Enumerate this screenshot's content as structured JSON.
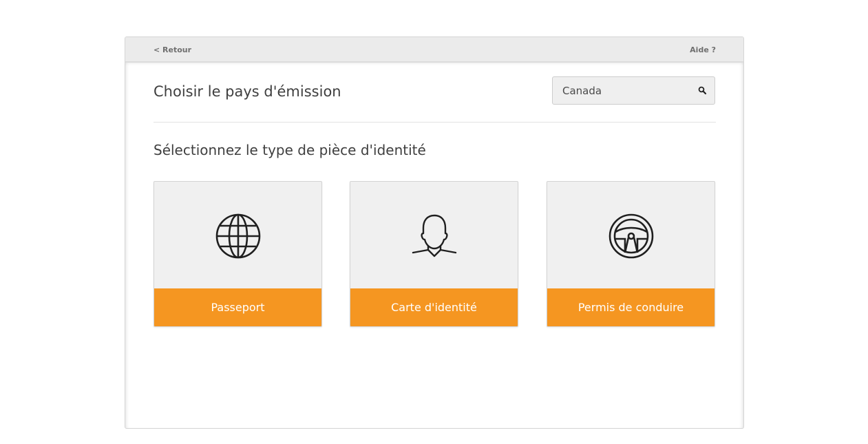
{
  "header": {
    "back_label": "< Retour",
    "help_label": "Aide ?"
  },
  "country": {
    "title": "Choisir le pays d'émission",
    "search_value": "Canada",
    "search_icon": "search-icon"
  },
  "document_type": {
    "title": "Sélectionnez le type de pièce d'identité",
    "options": [
      {
        "label": "Passeport",
        "icon": "globe-icon"
      },
      {
        "label": "Carte d'identité",
        "icon": "person-icon"
      },
      {
        "label": "Permis de conduire",
        "icon": "steering-wheel-icon"
      }
    ]
  },
  "colors": {
    "accent": "#f59621",
    "card_background": "#f0f0f0",
    "topbar_background": "#ebebeb"
  }
}
